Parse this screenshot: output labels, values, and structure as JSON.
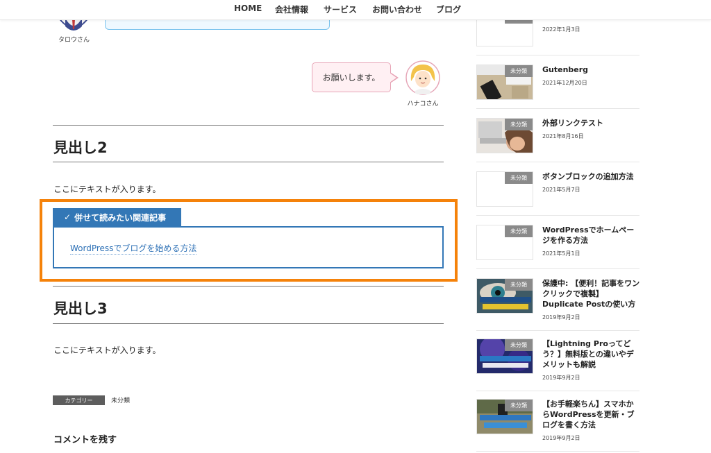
{
  "nav": {
    "items": [
      "HOME",
      "会社情報",
      "サービス",
      "お問い合わせ",
      "ブログ"
    ]
  },
  "chat": {
    "taro_name": "タロウさん",
    "hanako_name": "ハナコさん",
    "hanako_message": "お願いします。"
  },
  "article": {
    "heading2": "見出し2",
    "text1": "ここにテキストが入ります。",
    "related": {
      "label": "併せて読みたい関連記事",
      "link": "WordPressでブログを始める方法"
    },
    "heading3": "見出し3",
    "text2": "ここにテキストが入ります。",
    "category_label": "カテゴリー",
    "category_value": "未分類",
    "comment_heading": "コメントを残す"
  },
  "sidebar": {
    "badge": "未分類",
    "posts": [
      {
        "title": "",
        "date": "2022年1月3日",
        "thumb": "blank"
      },
      {
        "title": "Gutenberg",
        "date": "2021年12月20日",
        "thumb": "desk-phone"
      },
      {
        "title": "外部リンクテスト",
        "date": "2021年8月16日",
        "thumb": "laptop-woman"
      },
      {
        "title": "ボタンブロックの追加方法",
        "date": "2021年5月7日",
        "thumb": "blank"
      },
      {
        "title": "WordPressでホームページを作る方法",
        "date": "2021年5月1日",
        "thumb": "blank"
      },
      {
        "title": "保護中: 【便利！記事をワンクリックで複製】Duplicate Postの使い方",
        "date": "2019年9月2日",
        "thumb": "eye"
      },
      {
        "title": "【Lightning Proってどう？】無料版との違いやデメリットも解説",
        "date": "2019年9月2日",
        "thumb": "lightning"
      },
      {
        "title": "【お手軽楽ちん】スマホからWordPressを更新・ブログを書く方法",
        "date": "2019年9月2日",
        "thumb": "smartphone"
      }
    ]
  },
  "colors": {
    "highlight": "#f5820a",
    "related_blue": "#3377b6",
    "pink_bubble": "#fff0f3",
    "blue_bubble": "#eef8ff"
  }
}
